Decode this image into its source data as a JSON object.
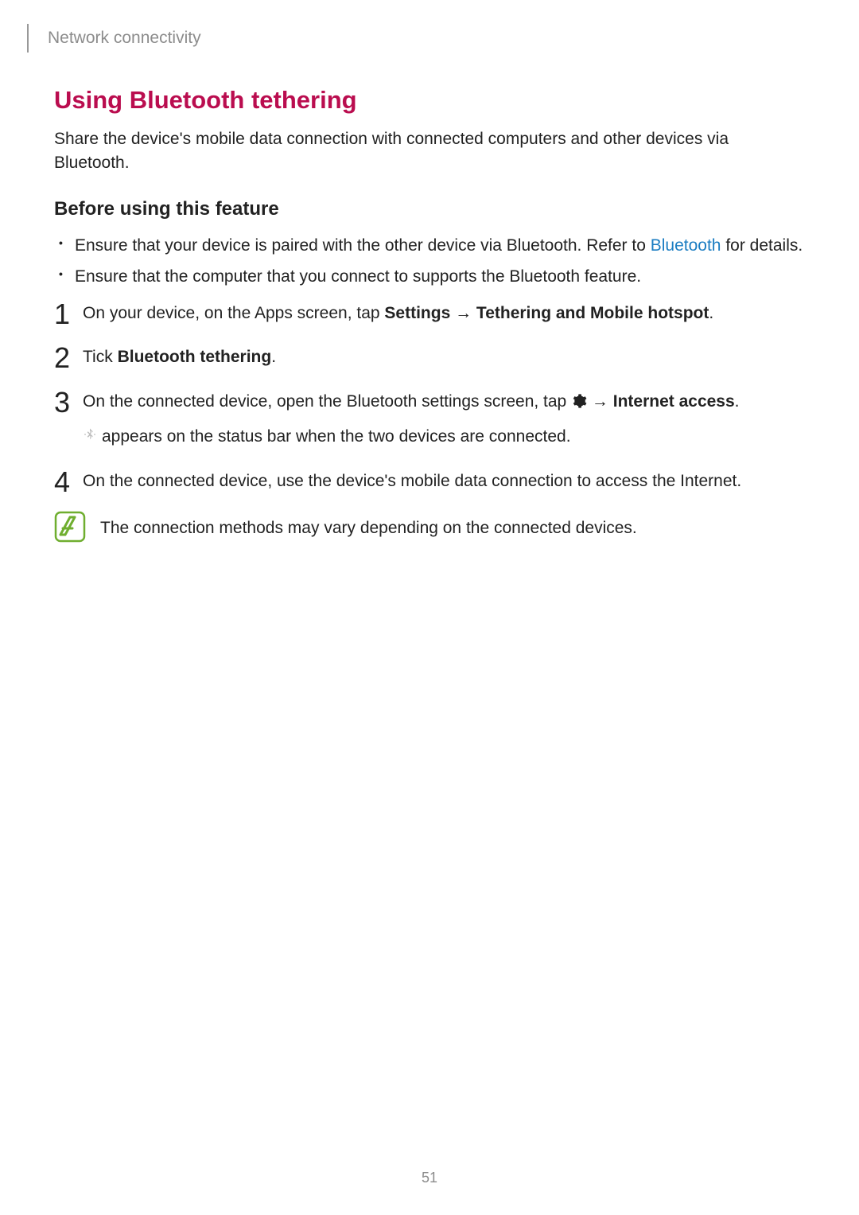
{
  "header": {
    "section": "Network connectivity"
  },
  "title": "Using Bluetooth tethering",
  "intro": "Share the device's mobile data connection with connected computers and other devices via Bluetooth.",
  "beforeHeading": "Before using this feature",
  "bullets": {
    "b1a": "Ensure that your device is paired with the other device via Bluetooth. Refer to ",
    "b1link": "Bluetooth",
    "b1b": " for details.",
    "b2": "Ensure that the computer that you connect to supports the Bluetooth feature."
  },
  "steps": {
    "s1a": "On your device, on the Apps screen, tap ",
    "s1b": "Settings",
    "s1arrow": " → ",
    "s1c": "Tethering and Mobile hotspot",
    "s1d": ".",
    "s2a": "Tick ",
    "s2b": "Bluetooth tethering",
    "s2c": ".",
    "s3a": "On the connected device, open the Bluetooth settings screen, tap ",
    "s3arrow": " → ",
    "s3b": "Internet access",
    "s3c": ".",
    "s3sub": " appears on the status bar when the two devices are connected.",
    "s4": "On the connected device, use the device's mobile data connection to access the Internet."
  },
  "note": "The connection methods may vary depending on the connected devices.",
  "pageNumber": "51"
}
